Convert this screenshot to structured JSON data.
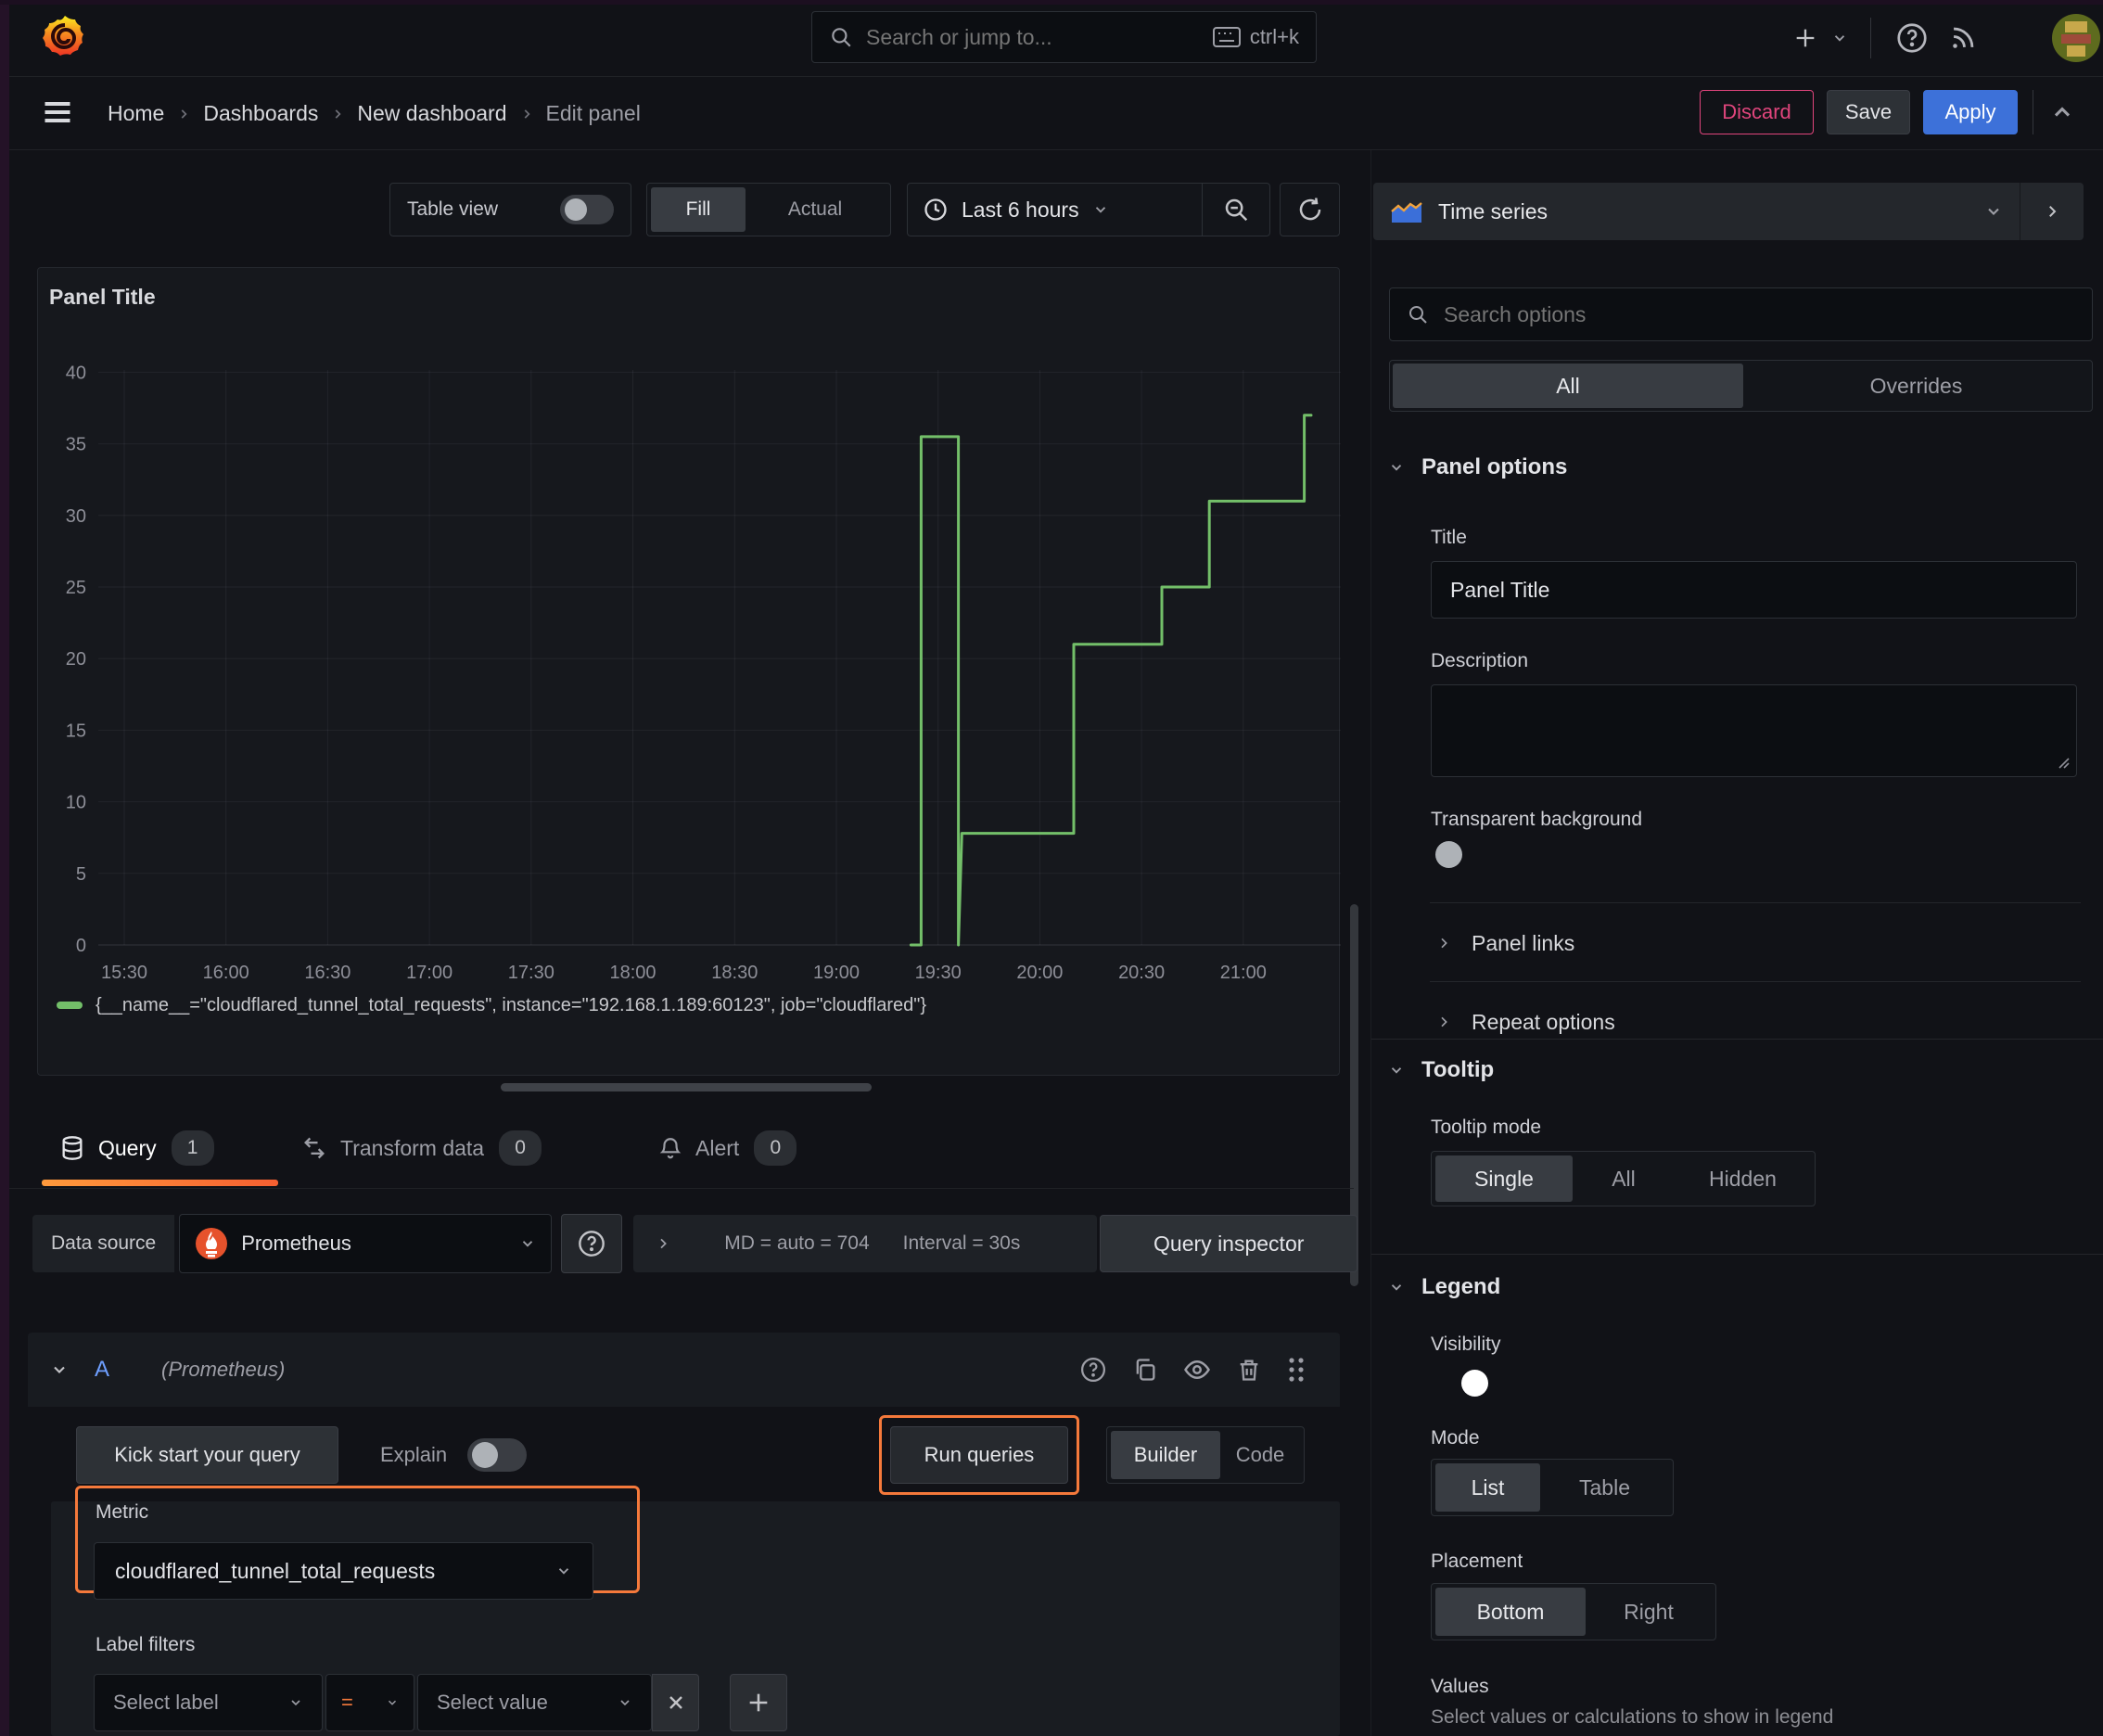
{
  "topbar": {
    "search_placeholder": "Search or jump to...",
    "shortcut": "ctrl+k"
  },
  "breadcrumb": {
    "items": [
      "Home",
      "Dashboards",
      "New dashboard",
      "Edit panel"
    ]
  },
  "actions": {
    "discard": "Discard",
    "save": "Save",
    "apply": "Apply"
  },
  "toolbar": {
    "table_view": "Table view",
    "fill": "Fill",
    "actual": "Actual",
    "time_range": "Last 6 hours"
  },
  "panel": {
    "title": "Panel Title"
  },
  "chart_data": {
    "type": "line",
    "title": "Panel Title",
    "series": [
      {
        "name": "{__name__=\"cloudflared_tunnel_total_requests\", instance=\"192.168.1.189:60123\", job=\"cloudflared\"}",
        "color": "#73BF69",
        "points": [
          [
            "19:22",
            0
          ],
          [
            "19:25",
            0
          ],
          [
            "19:25",
            35.5
          ],
          [
            "19:36",
            35.5
          ],
          [
            "19:36",
            0
          ],
          [
            "19:37",
            7.8
          ],
          [
            "20:10",
            7.8
          ],
          [
            "20:10",
            21
          ],
          [
            "20:36",
            21
          ],
          [
            "20:36",
            25
          ],
          [
            "20:50",
            25
          ],
          [
            "20:50",
            31
          ],
          [
            "21:18",
            31
          ],
          [
            "21:18",
            37
          ],
          [
            "21:20",
            37
          ]
        ]
      }
    ],
    "x_ticks": [
      "15:30",
      "16:00",
      "16:30",
      "17:00",
      "17:30",
      "18:00",
      "18:30",
      "19:00",
      "19:30",
      "20:00",
      "20:30",
      "21:00"
    ],
    "y_ticks": [
      0,
      5,
      10,
      15,
      20,
      25,
      30,
      35,
      40
    ],
    "ylim": [
      0,
      40
    ],
    "x_range": [
      "15:22",
      "21:29"
    ],
    "grid": true,
    "legend_position": "bottom",
    "xlabel": "",
    "ylabel": ""
  },
  "tabs": {
    "query": "Query",
    "query_count": "1",
    "transform": "Transform data",
    "transform_count": "0",
    "alert": "Alert",
    "alert_count": "0"
  },
  "datasource": {
    "label": "Data source",
    "name": "Prometheus",
    "summary_md": "MD = auto = 704",
    "summary_interval": "Interval = 30s",
    "inspector": "Query inspector"
  },
  "query": {
    "ref_id": "A",
    "ds_hint": "(Prometheus)",
    "kick_start": "Kick start your query",
    "explain": "Explain",
    "run": "Run queries",
    "builder": "Builder",
    "code": "Code",
    "metric_label": "Metric",
    "metric_value": "cloudflared_tunnel_total_requests",
    "filters_label": "Label filters",
    "select_label": "Select label",
    "operator": "=",
    "select_value": "Select value"
  },
  "options": {
    "visualization": "Time series",
    "search_placeholder": "Search options",
    "tab_all": "All",
    "tab_overrides": "Overrides",
    "panel_options_title": "Panel options",
    "title_label": "Title",
    "title_value": "Panel Title",
    "description_label": "Description",
    "transparent_label": "Transparent background",
    "panel_links": "Panel links",
    "repeat_options": "Repeat options",
    "tooltip_title": "Tooltip",
    "tooltip_mode_label": "Tooltip mode",
    "tooltip_modes": [
      "Single",
      "All",
      "Hidden"
    ],
    "tooltip_selected": "Single",
    "legend_title": "Legend",
    "visibility_label": "Visibility",
    "mode_label": "Mode",
    "modes": [
      "List",
      "Table"
    ],
    "mode_selected": "List",
    "placement_label": "Placement",
    "placements": [
      "Bottom",
      "Right"
    ],
    "placement_selected": "Bottom",
    "values_label": "Values",
    "values_hint": "Select values or calculations to show in legend"
  },
  "colors": {
    "accent_orange": "#F5793B",
    "green": "#73BF69",
    "blue": "#3D71D9",
    "pink": "#E0457C"
  }
}
